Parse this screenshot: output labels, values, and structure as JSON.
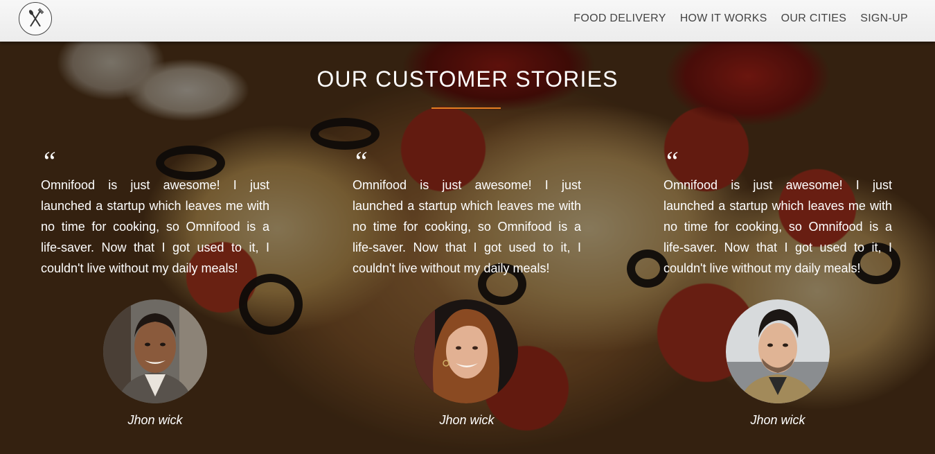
{
  "header": {
    "logo_icon": "fork-knife-logo-icon",
    "nav": [
      {
        "label": "FOOD DELIVERY"
      },
      {
        "label": "HOW IT WORKS"
      },
      {
        "label": "OUR CITIES"
      },
      {
        "label": "SIGN-UP"
      }
    ]
  },
  "section": {
    "title": "OUR CUSTOMER STORIES",
    "accent_color": "#e67e22",
    "stories": [
      {
        "quote_mark": "“",
        "text": "Omnifood is just awesome! I just launched a startup which leaves me with no time for cooking, so Omnifood is a life-saver. Now that I got used to it, I couldn't live without my daily meals!",
        "name": "Jhon wick"
      },
      {
        "quote_mark": "“",
        "text": "Omnifood is just awesome! I just launched a startup which leaves me with no time for cooking, so Omnifood is a life-saver. Now that I got used to it, I couldn't live without my daily meals!",
        "name": "Jhon wick"
      },
      {
        "quote_mark": "“",
        "text": "Omnifood is just awesome! I just launched a startup which leaves me with no time for cooking, so Omnifood is a life-saver. Now that I got used to it, I couldn't live without my daily meals!",
        "name": "Jhon wick"
      }
    ]
  }
}
